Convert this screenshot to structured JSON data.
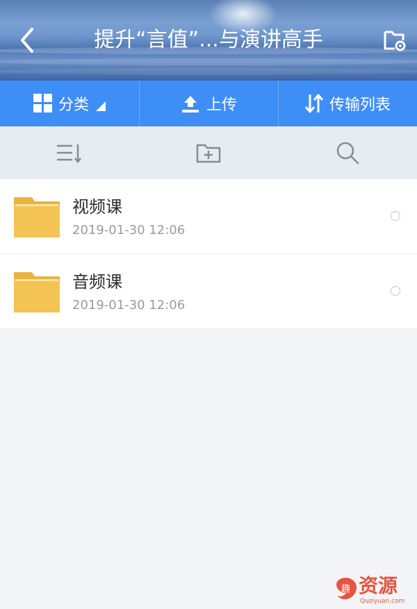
{
  "header": {
    "title": "提升“言值”...与演讲高手",
    "back_icon": "chevron-left-icon",
    "settings_icon": "folder-settings-icon"
  },
  "toolbar": {
    "category_label": "分类",
    "upload_label": "上传",
    "transfer_label": "传输列表"
  },
  "subbar": {
    "sort_icon": "sort-icon",
    "new_folder_icon": "new-folder-icon",
    "search_icon": "search-icon"
  },
  "files": [
    {
      "name": "视频课",
      "date": "2019-01-30  12:06",
      "icon": "folder-icon"
    },
    {
      "name": "音频课",
      "date": "2019-01-30  12:06",
      "icon": "folder-icon"
    }
  ],
  "watermark": {
    "logo_char": "趣",
    "text": "资源",
    "sub": "Quziyuan.com"
  },
  "colors": {
    "toolbar": "#3e8ef7",
    "subbar": "#e6ecef",
    "folder": "#f3c453",
    "watermark": "#e8543f"
  }
}
